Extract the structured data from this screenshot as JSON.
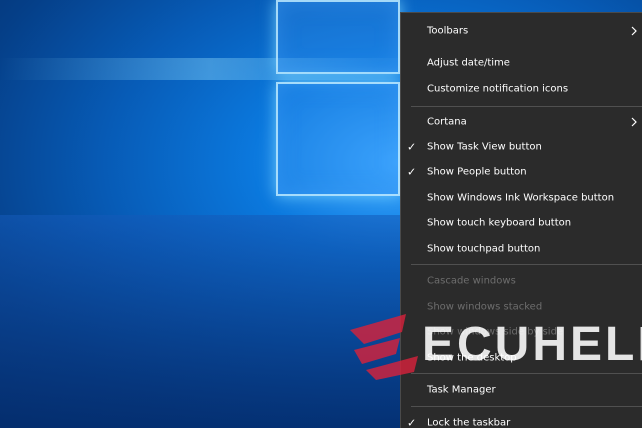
{
  "menu": {
    "items": [
      {
        "label": "Toolbars",
        "submenu": true
      },
      {
        "label": "Adjust date/time",
        "highlighted": true
      },
      {
        "label": "Customize notification icons"
      },
      {
        "label": "Cortana",
        "submenu": true
      },
      {
        "label": "Show Task View button",
        "checked": true
      },
      {
        "label": "Show People button",
        "checked": true
      },
      {
        "label": "Show Windows Ink Workspace button"
      },
      {
        "label": "Show touch keyboard button"
      },
      {
        "label": "Show touchpad button"
      },
      {
        "label": "Cascade windows",
        "disabled": true
      },
      {
        "label": "Show windows stacked",
        "disabled": true
      },
      {
        "label": "Show windows side by side",
        "disabled": true
      },
      {
        "label": "Show the desktop"
      },
      {
        "label": "Task Manager"
      },
      {
        "label": "Lock the taskbar",
        "checked": true
      }
    ],
    "check_glyph": "✓",
    "highlight_color": "#e2371f",
    "background_color": "#2b2b2b",
    "disabled_color": "#6d6d6d"
  },
  "watermark": {
    "text": "ECUHELP",
    "logo_color": "#d6223c"
  },
  "desktop": {
    "wallpaper": "Windows 10 light window",
    "accent_color": "#0b78dd"
  }
}
